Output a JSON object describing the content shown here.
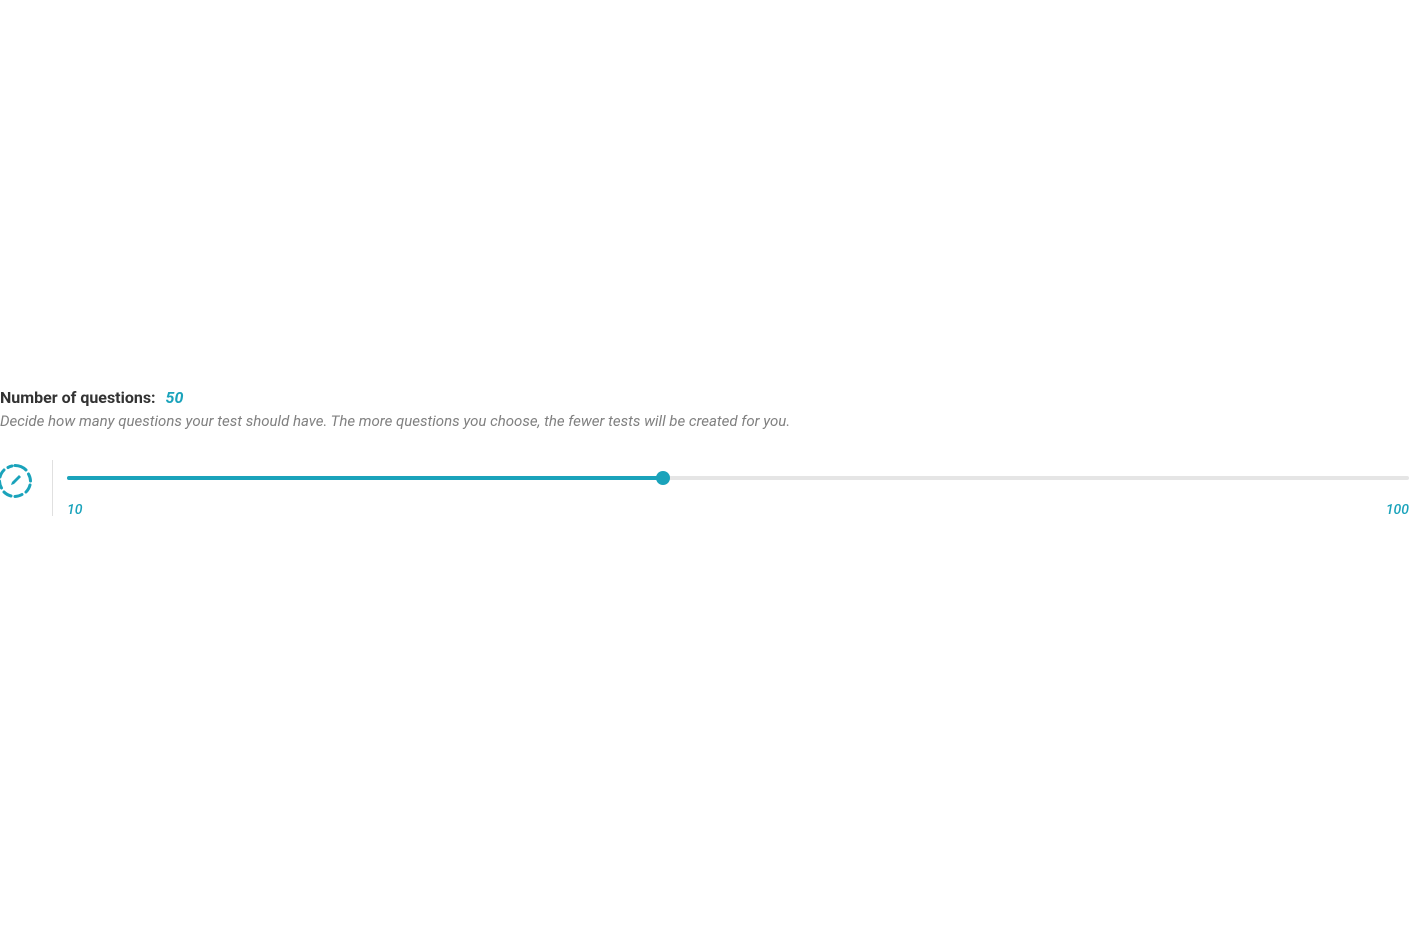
{
  "header": {
    "title_label": "Number of questions:",
    "title_value": "50",
    "description": "Decide how many questions your test should have. The more questions you choose, the fewer tests will be created for you."
  },
  "slider": {
    "min": 10,
    "max": 100,
    "value": 50,
    "min_label": "10",
    "max_label": "100",
    "fill_percent": "44.4",
    "thumb_percent": "44.4"
  },
  "colors": {
    "accent": "#1aa3bb",
    "track_bg": "#e5e5e5",
    "text_primary": "#333333",
    "text_secondary": "#808080"
  }
}
